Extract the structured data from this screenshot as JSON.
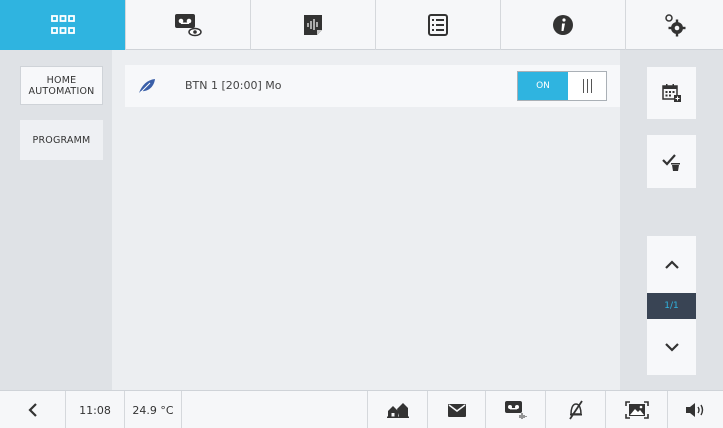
{
  "colors": {
    "accent": "#2fb4e0",
    "dark": "#394454"
  },
  "topbar": {
    "tabs": [
      {
        "icon": "grid-apps-icon",
        "active": true
      },
      {
        "icon": "intercom-camera-icon",
        "active": false
      },
      {
        "icon": "voice-memo-icon",
        "active": false
      },
      {
        "icon": "list-icon",
        "active": false
      },
      {
        "icon": "info-icon",
        "active": false
      },
      {
        "icon": "settings-gears-icon",
        "active": false
      }
    ]
  },
  "sidebar": {
    "items": [
      {
        "label_line1": "HOME",
        "label_line2": "AUTOMATION"
      },
      {
        "label": "PROGRAMM"
      }
    ]
  },
  "main": {
    "row": {
      "label": "BTN 1 [20:00] Mo",
      "icon": "leaf-icon",
      "toggle_label": "ON"
    }
  },
  "rightbar": {
    "page": "1/1"
  },
  "bottombar": {
    "time": "11:08",
    "temperature": "24.9 °C"
  }
}
